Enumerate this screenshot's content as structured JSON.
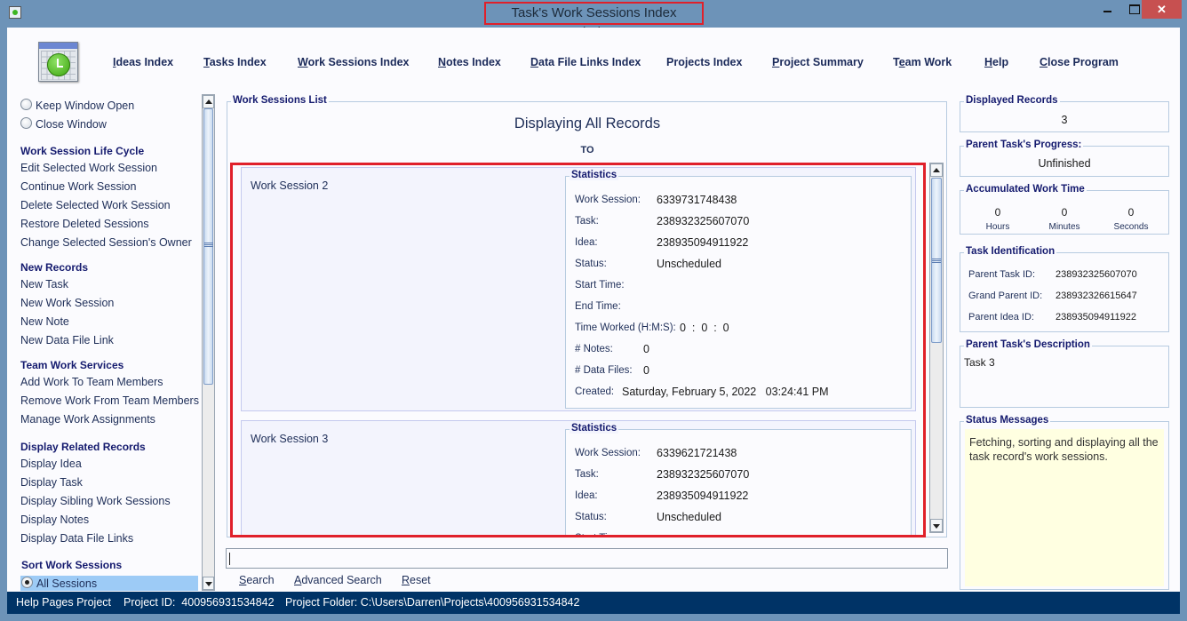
{
  "window": {
    "title": "Task's Work Sessions Index Window",
    "controls": {
      "minimize": "minimize",
      "maximize": "maximize",
      "close": "✕"
    }
  },
  "nav": [
    {
      "label": "Ideas Index",
      "mnemonic": "I"
    },
    {
      "label": "Tasks Index",
      "mnemonic": "T"
    },
    {
      "label": "Work Sessions Index",
      "mnemonic": "W"
    },
    {
      "label": "Notes Index",
      "mnemonic": "N"
    },
    {
      "label": "Data File Links Index",
      "mnemonic": "D"
    },
    {
      "label": "Projects Index",
      "mnemonic": ""
    },
    {
      "label": "Project Summary",
      "mnemonic": "P"
    },
    {
      "label": "Team Work",
      "mnemonic": "e"
    },
    {
      "label": "Help",
      "mnemonic": "H"
    },
    {
      "label": "Close Program",
      "mnemonic": "C"
    }
  ],
  "sidebar": {
    "radios": [
      {
        "label": "Keep Window Open",
        "checked": false
      },
      {
        "label": "Close Window",
        "checked": false
      }
    ],
    "sections": [
      {
        "heading": "Work Session Life Cycle",
        "items": [
          "Edit Selected Work Session",
          "Continue Work Session",
          "Delete Selected Work Session",
          "Restore Deleted Sessions",
          "Change Selected Session's Owner"
        ]
      },
      {
        "heading": "New Records",
        "items": [
          "New Task",
          "New Work Session",
          "New Note",
          "New Data File Link"
        ]
      },
      {
        "heading": "Team Work Services",
        "items": [
          "Add Work To Team Members",
          "Remove Work From Team Members",
          "Manage Work Assignments"
        ]
      },
      {
        "heading": "Display Related Records",
        "items": [
          "Display Idea",
          "Display Task",
          "Display Sibling Work Sessions",
          "Display Notes",
          "Display Data File Links"
        ]
      },
      {
        "heading": "Sort Work Sessions",
        "items": []
      }
    ],
    "sort_option": {
      "label": "All Sessions",
      "checked": true
    }
  },
  "main": {
    "group_title": "Work Sessions List",
    "heading": "Displaying All Records",
    "to_label": "TO",
    "stats_title": "Statistics",
    "labels": {
      "work_session": "Work Session:",
      "task": "Task:",
      "idea": "Idea:",
      "status": "Status:",
      "start_time": "Start Time:",
      "end_time": "End Time:",
      "time_worked": "Time Worked (H:M:S):",
      "notes": "# Notes:",
      "data_files": "# Data Files:",
      "created": "Created:"
    },
    "sessions": [
      {
        "name": "Work Session 2",
        "work_session": "6339731748438",
        "task": "238932325607070",
        "idea": "238935094911922",
        "status": "Unscheduled",
        "start_time": "",
        "end_time": "",
        "time_worked": "0  :  0  :  0",
        "notes": "0",
        "data_files": "0",
        "created": "Saturday, February 5, 2022   03:24:41 PM"
      },
      {
        "name": "Work Session 3",
        "work_session": "6339621721438",
        "task": "238932325607070",
        "idea": "238935094911922",
        "status": "Unscheduled",
        "start_time": "",
        "end_time": "",
        "time_worked": "",
        "notes": "",
        "data_files": "",
        "created": ""
      }
    ],
    "search": {
      "value": "",
      "placeholder": ""
    },
    "search_buttons": [
      {
        "label": "Search",
        "mnemonic": "S"
      },
      {
        "label": "Advanced Search",
        "mnemonic": "A"
      },
      {
        "label": "Reset",
        "mnemonic": "R"
      }
    ]
  },
  "right": {
    "displayed_records": {
      "title": "Displayed Records",
      "value": "3"
    },
    "progress": {
      "title": "Parent Task's Progress:",
      "value": "Unfinished"
    },
    "work_time": {
      "title": "Accumulated Work Time",
      "hours": "0",
      "minutes": "0",
      "seconds": "0",
      "hours_label": "Hours",
      "minutes_label": "Minutes",
      "seconds_label": "Seconds"
    },
    "task_identification": {
      "title": "Task Identification",
      "rows": [
        {
          "label": "Parent Task ID:",
          "value": "238932325607070"
        },
        {
          "label": "Grand Parent ID:",
          "value": "238932326615647"
        },
        {
          "label": "Parent Idea ID:",
          "value": "238935094911922"
        }
      ]
    },
    "description": {
      "title": "Parent Task's Description",
      "value": "Task 3"
    },
    "status_messages": {
      "title": "Status Messages",
      "value": "Fetching, sorting and displaying all the task record's work sessions."
    }
  },
  "statusbar": {
    "project_name": "Help Pages Project",
    "project_id": "Project ID:  400956931534842",
    "project_folder": "Project Folder: C:\\Users\\Darren\\Projects\\400956931534842"
  },
  "colors": {
    "frame": "#6d93b8",
    "status_bar": "#003366",
    "highlight_outline": "#e0202a",
    "heading_text": "#141a6e",
    "status_message_bg": "#ffffe1",
    "selected_row": "#9dcbf6",
    "close_button": "#c75050"
  }
}
